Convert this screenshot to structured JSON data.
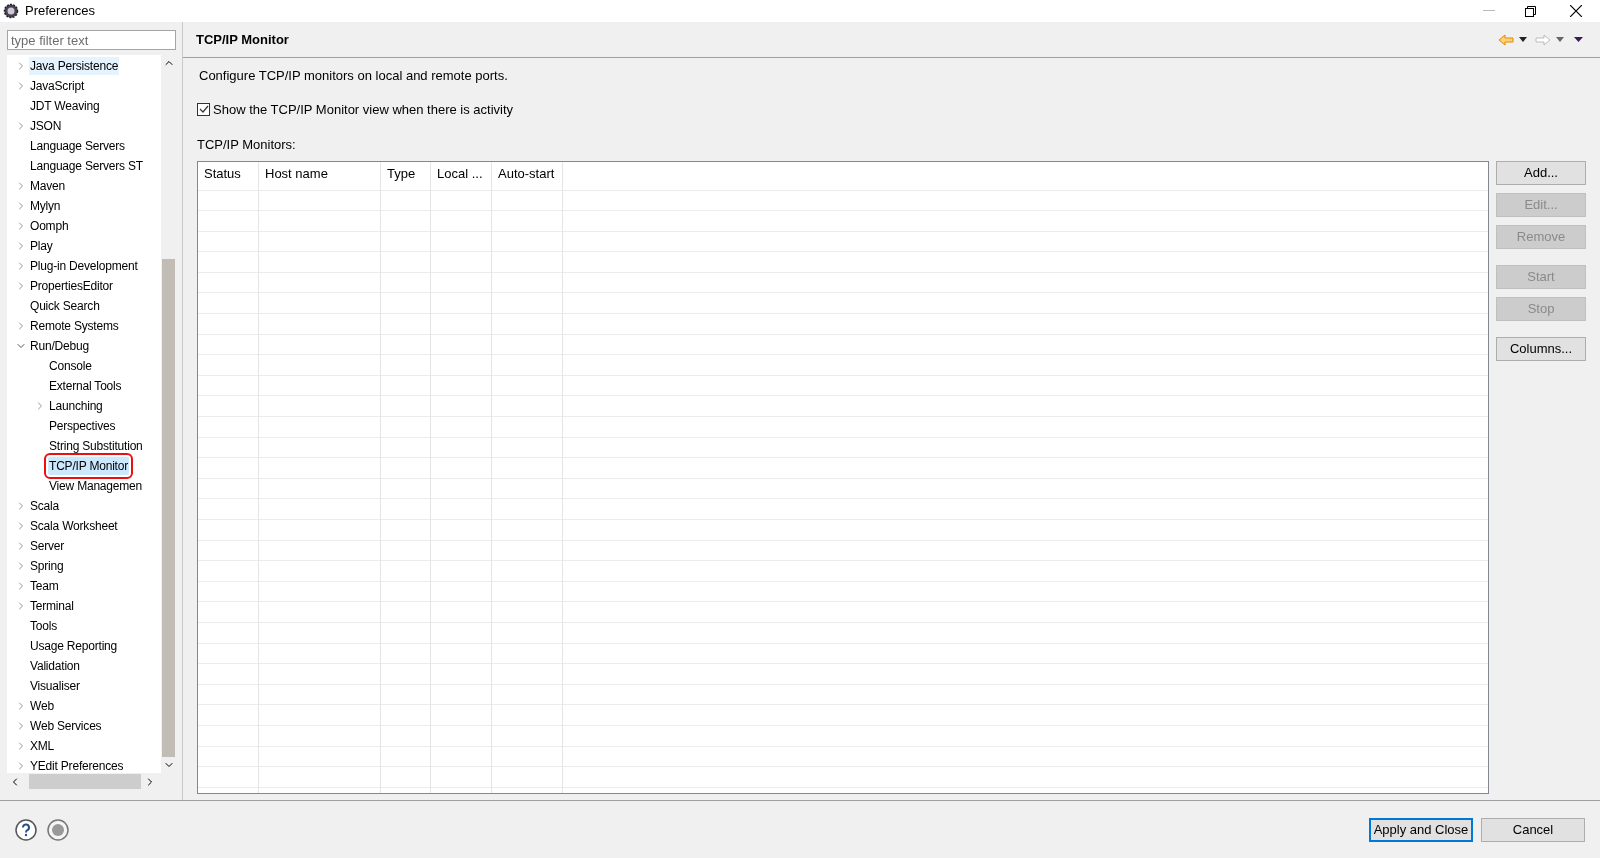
{
  "window": {
    "title": "Preferences"
  },
  "filter": {
    "placeholder": "type filter text"
  },
  "tree": [
    {
      "label": "Java Persistence",
      "expanded": false,
      "selected": false,
      "hovered": true,
      "annotated": false
    },
    {
      "label": "JavaScript",
      "expanded": false,
      "selected": false,
      "hovered": false,
      "annotated": false
    },
    {
      "label": "JDT Weaving",
      "selected": false,
      "hovered": false,
      "annotated": false
    },
    {
      "label": "JSON",
      "expanded": false,
      "selected": false,
      "hovered": false,
      "annotated": false
    },
    {
      "label": "Language Servers",
      "selected": false,
      "hovered": false,
      "annotated": false
    },
    {
      "label": "Language Servers ST",
      "selected": false,
      "hovered": false,
      "annotated": false
    },
    {
      "label": "Maven",
      "expanded": false,
      "selected": false,
      "hovered": false,
      "annotated": false
    },
    {
      "label": "Mylyn",
      "expanded": false,
      "selected": false,
      "hovered": false,
      "annotated": false
    },
    {
      "label": "Oomph",
      "expanded": false,
      "selected": false,
      "hovered": false,
      "annotated": false
    },
    {
      "label": "Play",
      "expanded": false,
      "selected": false,
      "hovered": false,
      "annotated": false
    },
    {
      "label": "Plug-in Development",
      "expanded": false,
      "selected": false,
      "hovered": false,
      "annotated": false
    },
    {
      "label": "PropertiesEditor",
      "expanded": false,
      "selected": false,
      "hovered": false,
      "annotated": false
    },
    {
      "label": "Quick Search",
      "selected": false,
      "hovered": false,
      "annotated": false
    },
    {
      "label": "Remote Systems",
      "expanded": false,
      "selected": false,
      "hovered": false,
      "annotated": false
    },
    {
      "label": "Run/Debug",
      "expanded": true,
      "selected": false,
      "hovered": false,
      "annotated": false,
      "children": [
        {
          "label": "Console",
          "selected": false,
          "hovered": false,
          "annotated": false
        },
        {
          "label": "External Tools",
          "selected": false,
          "hovered": false,
          "annotated": false
        },
        {
          "label": "Launching",
          "expanded": false,
          "selected": false,
          "hovered": false,
          "annotated": false
        },
        {
          "label": "Perspectives",
          "selected": false,
          "hovered": false,
          "annotated": false
        },
        {
          "label": "String Substitution",
          "selected": false,
          "hovered": false,
          "annotated": false
        },
        {
          "label": "TCP/IP Monitor",
          "selected": true,
          "hovered": false,
          "annotated": true
        },
        {
          "label": "View Managemen",
          "selected": false,
          "hovered": false,
          "annotated": false
        }
      ]
    },
    {
      "label": "Scala",
      "expanded": false,
      "selected": false,
      "hovered": false,
      "annotated": false
    },
    {
      "label": "Scala Worksheet",
      "expanded": false,
      "selected": false,
      "hovered": false,
      "annotated": false
    },
    {
      "label": "Server",
      "expanded": false,
      "selected": false,
      "hovered": false,
      "annotated": false
    },
    {
      "label": "Spring",
      "expanded": false,
      "selected": false,
      "hovered": false,
      "annotated": false
    },
    {
      "label": "Team",
      "expanded": false,
      "selected": false,
      "hovered": false,
      "annotated": false
    },
    {
      "label": "Terminal",
      "expanded": false,
      "selected": false,
      "hovered": false,
      "annotated": false
    },
    {
      "label": "Tools",
      "selected": false,
      "hovered": false,
      "annotated": false
    },
    {
      "label": "Usage Reporting",
      "selected": false,
      "hovered": false,
      "annotated": false
    },
    {
      "label": "Validation",
      "selected": false,
      "hovered": false,
      "annotated": false
    },
    {
      "label": "Visualiser",
      "selected": false,
      "hovered": false,
      "annotated": false
    },
    {
      "label": "Web",
      "expanded": false,
      "selected": false,
      "hovered": false,
      "annotated": false
    },
    {
      "label": "Web Services",
      "expanded": false,
      "selected": false,
      "hovered": false,
      "annotated": false
    },
    {
      "label": "XML",
      "expanded": false,
      "selected": false,
      "hovered": false,
      "annotated": false
    },
    {
      "label": "YEdit Preferences",
      "expanded": false,
      "selected": false,
      "hovered": false,
      "annotated": false
    }
  ],
  "page": {
    "title": "TCP/IP Monitor",
    "description": "Configure TCP/IP monitors on local and remote ports.",
    "show_view_checkbox": {
      "label": "Show the TCP/IP Monitor view when there is activity",
      "checked": true
    },
    "table_label": "TCP/IP Monitors:",
    "table": {
      "columns": [
        "Status",
        "Host name",
        "Type",
        "Local ...",
        "Auto-start"
      ]
    },
    "button_groups": [
      [
        {
          "label": "Add...",
          "disabled": false
        },
        {
          "label": "Edit...",
          "disabled": true
        },
        {
          "label": "Remove",
          "disabled": true
        }
      ],
      [
        {
          "label": "Start",
          "disabled": true
        },
        {
          "label": "Stop",
          "disabled": true
        }
      ],
      [
        {
          "label": "Columns...",
          "disabled": false
        }
      ]
    ]
  },
  "footer": {
    "buttons": [
      {
        "label": "Apply and Close",
        "default": true
      },
      {
        "label": "Cancel",
        "default": false
      }
    ]
  }
}
